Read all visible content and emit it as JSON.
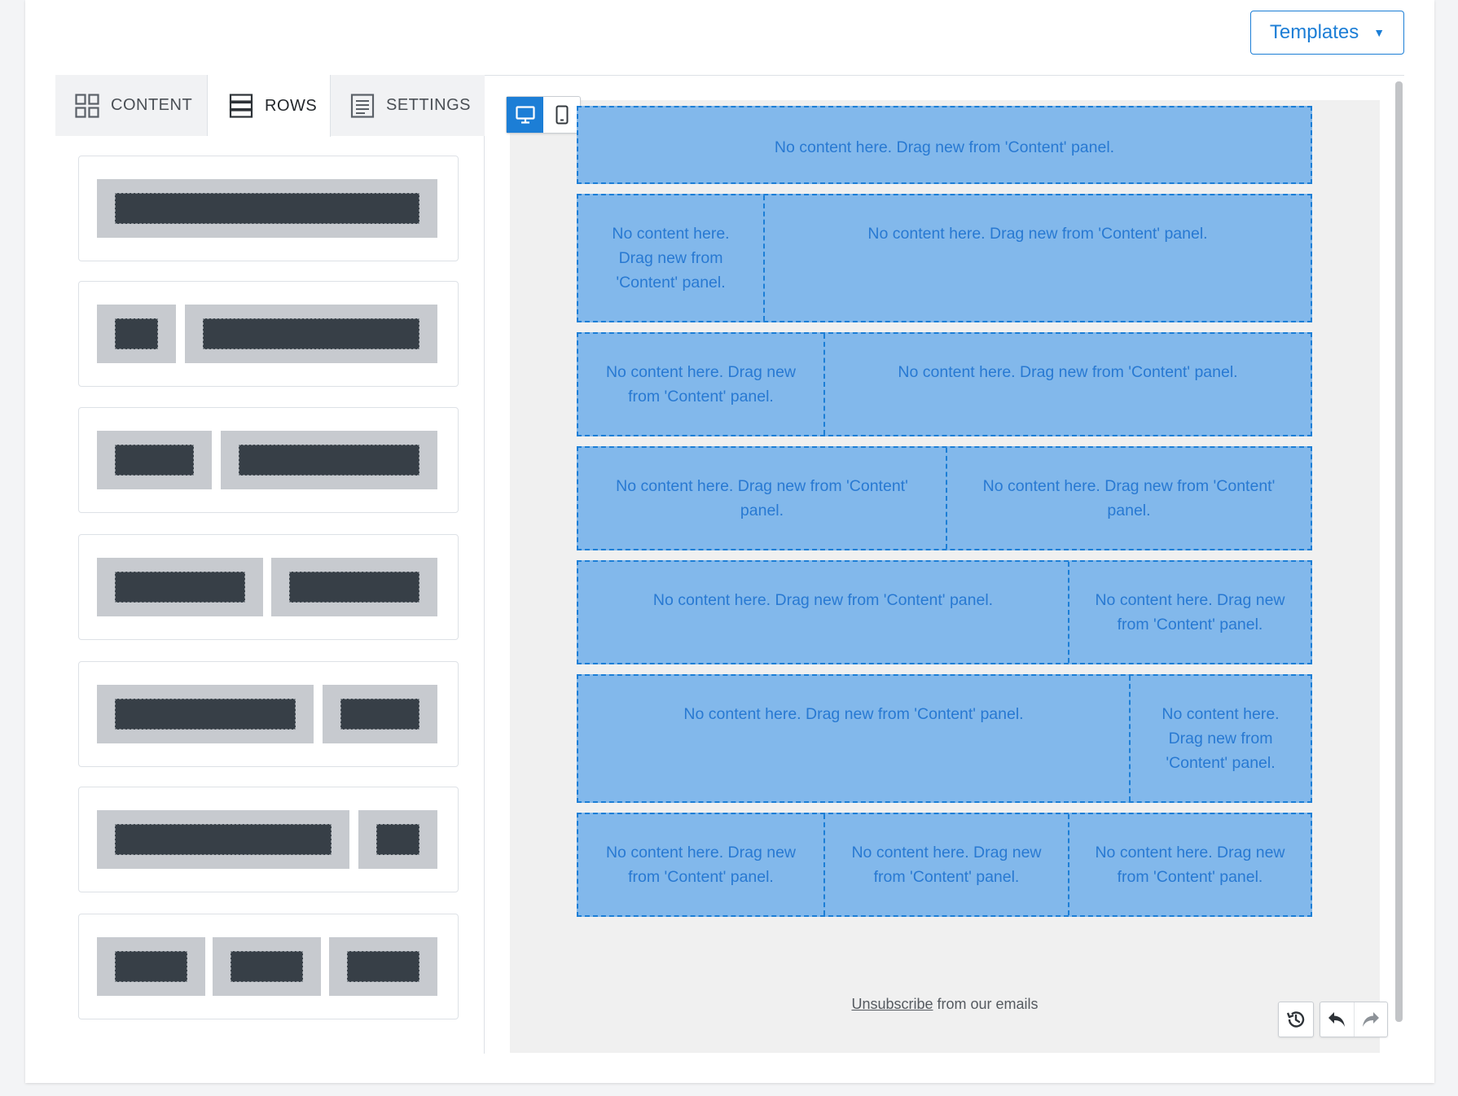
{
  "header": {
    "templates_label": "Templates",
    "templates_caret": "▼"
  },
  "tabs": [
    {
      "label": "CONTENT",
      "icon": "grid-icon",
      "active": false
    },
    {
      "label": "ROWS",
      "icon": "rows-icon",
      "active": true
    },
    {
      "label": "SETTINGS",
      "icon": "settings-icon",
      "active": false
    }
  ],
  "row_layouts": [
    {
      "columns": 1
    },
    {
      "columns": 2
    },
    {
      "columns": 2
    },
    {
      "columns": 2
    },
    {
      "columns": 2
    },
    {
      "columns": 2
    },
    {
      "columns": 3
    }
  ],
  "device_switch": {
    "desktop_icon": "desktop-icon",
    "mobile_icon": "mobile-icon",
    "active": "desktop"
  },
  "email_rows": [
    {
      "cells": [
        "No content here. Drag new from 'Content' panel."
      ]
    },
    {
      "cells": [
        "No content here. Drag new from 'Content' panel.",
        "No content here. Drag new from 'Content' panel."
      ]
    },
    {
      "cells": [
        "No content here. Drag new from 'Content' panel.",
        "No content here. Drag new from 'Content' panel."
      ]
    },
    {
      "cells": [
        "No content here. Drag new from 'Content' panel.",
        "No content here. Drag new from 'Content' panel."
      ]
    },
    {
      "cells": [
        "No content here. Drag new from 'Content' panel.",
        "No content here. Drag new from 'Content' panel."
      ]
    },
    {
      "cells": [
        "No content here. Drag new from 'Content' panel.",
        "No content here. Drag new from 'Content' panel."
      ]
    },
    {
      "cells": [
        "No content here. Drag new from 'Content' panel.",
        "No content here. Drag new from 'Content' panel.",
        "No content here. Drag new from 'Content' panel."
      ]
    }
  ],
  "footer": {
    "unsubscribe_link": "Unsubscribe",
    "unsubscribe_rest": " from our emails"
  },
  "colors": {
    "accent": "#1c7ed6",
    "dropzone_fill": "#82b8eb",
    "placeholder_bar": "#373f47"
  }
}
